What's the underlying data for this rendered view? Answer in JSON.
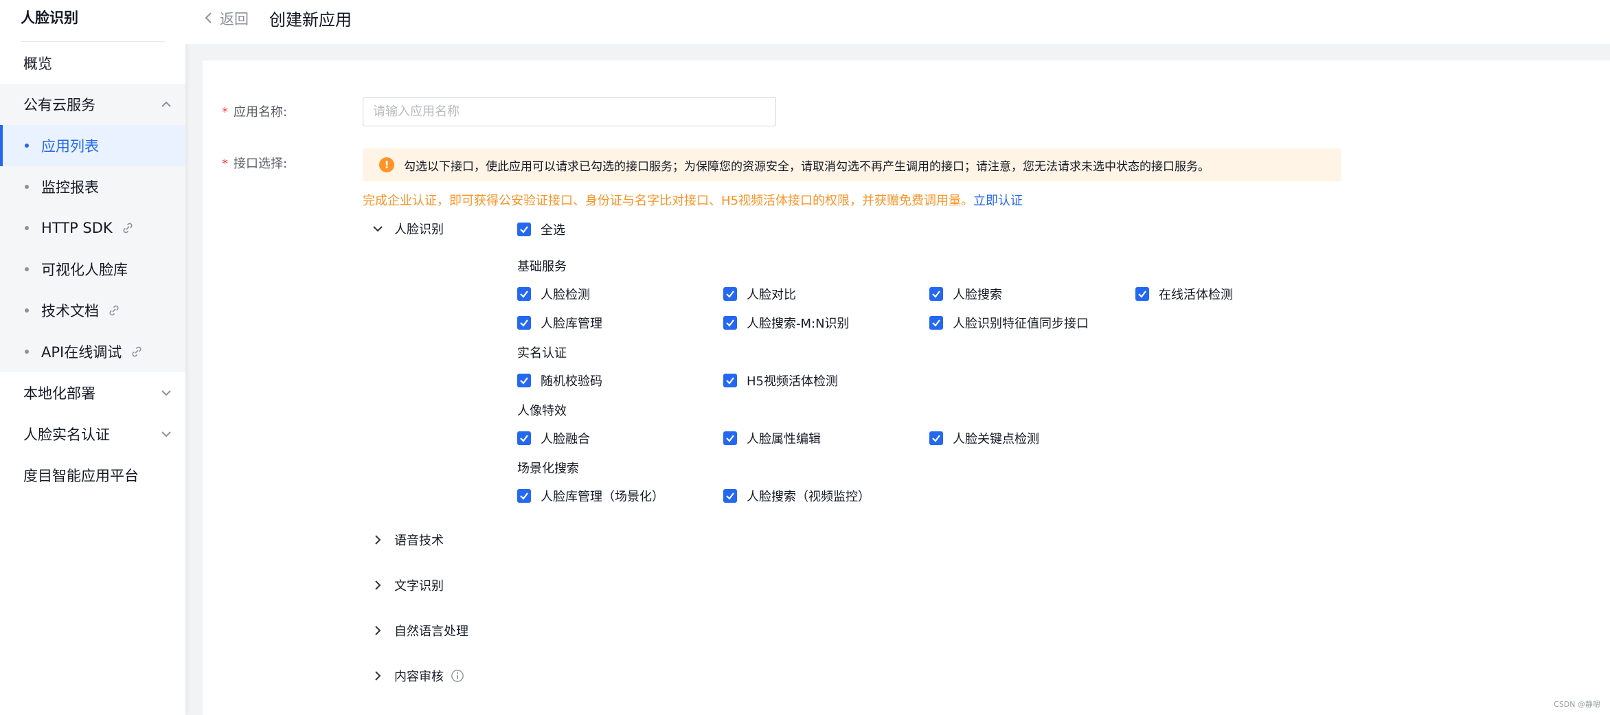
{
  "sidebar": {
    "title": "人脸识别",
    "items": {
      "overview": "概览",
      "public_cloud": "公有云服务",
      "local_deploy": "本地化部署",
      "realname": "人脸实名认证",
      "platform": "度目智能应用平台"
    },
    "sub_items": [
      {
        "label": "应用列表",
        "active": true,
        "icon": "dot"
      },
      {
        "label": "监控报表",
        "icon": "dot"
      },
      {
        "label": "HTTP SDK",
        "icon": "link-icon"
      },
      {
        "label": "可视化人脸库",
        "icon": "dot"
      },
      {
        "label": "技术文档",
        "icon": "link-icon"
      },
      {
        "label": "API在线调试",
        "icon": "link-icon"
      }
    ]
  },
  "header": {
    "back": "返回",
    "title": "创建新应用"
  },
  "form": {
    "name_label": "应用名称:",
    "name_placeholder": "请输入应用名称",
    "name_value": "",
    "api_label": "接口选择:",
    "required_mark": "*",
    "notice": "勾选以下接口，使此应用可以请求已勾选的接口服务；为保障您的资源安全，请取消勾选不再产生调用的接口；请注意，您无法请求未选中状态的接口服务。",
    "notice_icon": "!",
    "cert_text": "完成企业认证，即可获得公安验证接口、身份证与名字比对接口、H5视频活体接口的权限，并获赠免费调用量。",
    "cert_link": "立即认证"
  },
  "categories": {
    "face": "人脸识别",
    "speech": "语音技术",
    "ocr": "文字识别",
    "nlp": "自然语言处理",
    "audit": "内容审核"
  },
  "face_apis": {
    "select_all": "全选",
    "groups": [
      {
        "title": "基础服务",
        "items": [
          "人脸检测",
          "人脸对比",
          "人脸搜索",
          "在线活体检测",
          "人脸库管理",
          "人脸搜索-M:N识别",
          "人脸识别特征值同步接口"
        ]
      },
      {
        "title": "实名认证",
        "items": [
          "随机校验码",
          "H5视频活体检测"
        ]
      },
      {
        "title": "人像特效",
        "items": [
          "人脸融合",
          "人脸属性编辑",
          "人脸关键点检测"
        ]
      },
      {
        "title": "场景化搜索",
        "items": [
          "人脸库管理（场景化）",
          "人脸搜索（视频监控）"
        ]
      }
    ]
  },
  "watermark": "CSDN @静嗯",
  "colors": {
    "accent": "#2468f2",
    "warning": "#ff9326",
    "notice_bg": "#fff4e6",
    "required": "#f33e3e"
  }
}
